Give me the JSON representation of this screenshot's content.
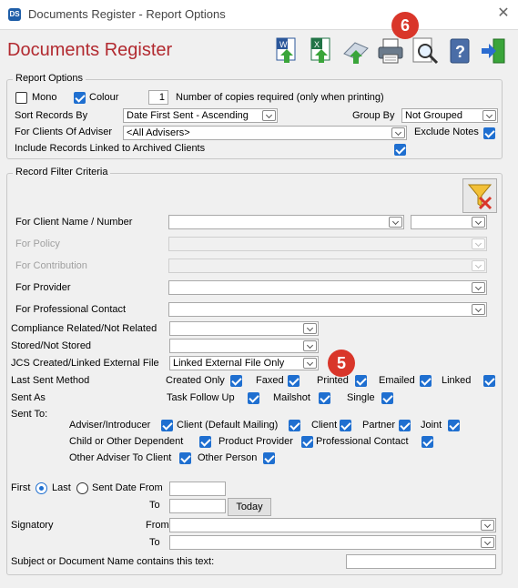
{
  "window": {
    "title": "Documents Register - Report Options",
    "app_icon": "DS",
    "close": "✕"
  },
  "heading": "Documents Register",
  "toolbar": {
    "buttons": [
      "word-export-icon",
      "excel-export-icon",
      "print-preview-icon",
      "printer-icon",
      "search-icon",
      "help-icon",
      "exit-icon"
    ]
  },
  "callouts": {
    "c6": "6",
    "c5": "5"
  },
  "report_options": {
    "group_label": "Report Options",
    "mono_label": "Mono",
    "colour_label": "Colour",
    "copies_value": "1",
    "copies_label": "Number of copies required (only when printing)",
    "sort_label": "Sort Records By",
    "sort_value": "Date First Sent - Ascending",
    "group_by_label": "Group By",
    "group_by_value": "Not Grouped",
    "clients_of_adviser_label": "For Clients Of Adviser",
    "clients_of_adviser_value": "<All Advisers>",
    "exclude_notes_label": "Exclude Notes",
    "include_archived_label": "Include Records Linked to Archived Clients"
  },
  "filter": {
    "group_label": "Record Filter Criteria",
    "client_label": "For Client Name / Number",
    "policy_label": "For Policy",
    "contribution_label": "For Contribution",
    "provider_label": "For Provider",
    "professional_contact_label": "For Professional Contact",
    "compliance_label": "Compliance Related/Not Related",
    "stored_label": "Stored/Not Stored",
    "jcs_label": "JCS Created/Linked External File",
    "jcs_value": "Linked External File Only",
    "last_sent_method_label": "Last Sent Method",
    "methods": [
      "Created Only",
      "Faxed",
      "Printed",
      "Emailed",
      "Linked"
    ],
    "sent_as_label": "Sent As",
    "sent_as": [
      "Task Follow Up",
      "Mailshot",
      "Single"
    ],
    "sent_to_label": "Sent To:",
    "sent_to": [
      "Adviser/Introducer",
      "Client (Default Mailing)",
      "Client",
      "Partner",
      "Joint",
      "Child or Other Dependent",
      "Product Provider",
      "Professional Contact",
      "Other Adviser To Client",
      "Other Person"
    ],
    "first_label": "First",
    "last_label": "Last",
    "sent_date_from_label": "Sent Date From",
    "to_label": "To",
    "today_label": "Today",
    "signatory_label": "Signatory",
    "from_label": "From",
    "subject_label": "Subject or Document Name contains this text:"
  }
}
